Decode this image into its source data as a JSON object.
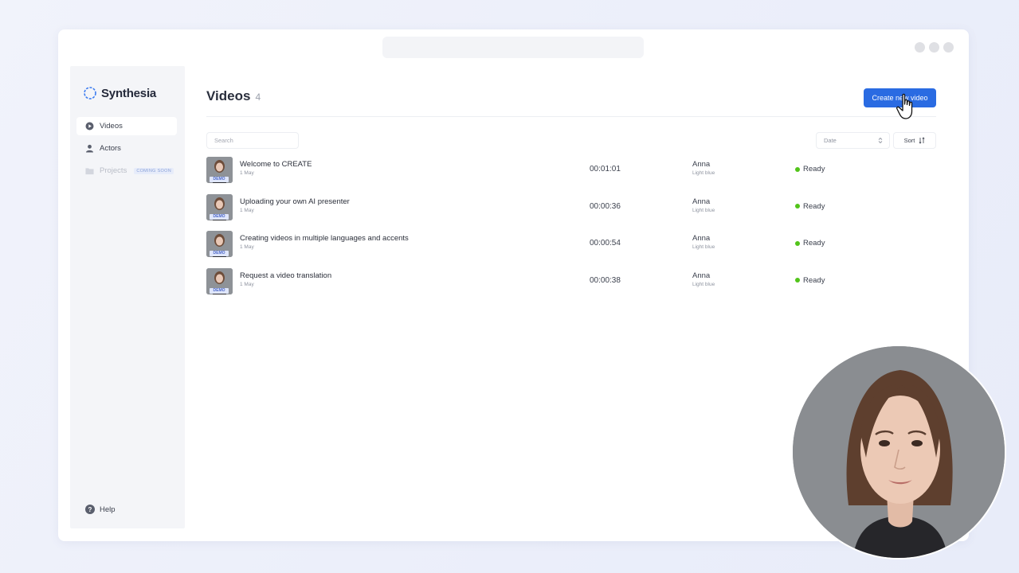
{
  "app": {
    "name": "Synthesia"
  },
  "sidebar": {
    "items": [
      {
        "label": "Videos",
        "icon": "play-circle-icon"
      },
      {
        "label": "Actors",
        "icon": "person-icon"
      },
      {
        "label": "Projects",
        "icon": "folder-icon",
        "badge": "COMING SOON"
      }
    ],
    "help_label": "Help"
  },
  "main": {
    "title": "Videos",
    "count": "4",
    "create_label": "Create new video",
    "search_placeholder": "Search",
    "date_select": "Date",
    "sort_label": "Sort"
  },
  "videos": [
    {
      "title": "Welcome to CREATE",
      "date": "1 May",
      "duration": "00:01:01",
      "actor": "Anna",
      "background": "Light blue",
      "status": "Ready",
      "tag": "DEMO"
    },
    {
      "title": "Uploading your own AI presenter",
      "date": "1 May",
      "duration": "00:00:36",
      "actor": "Anna",
      "background": "Light blue",
      "status": "Ready",
      "tag": "DEMO"
    },
    {
      "title": "Creating videos in multiple languages and accents",
      "date": "1 May",
      "duration": "00:00:54",
      "actor": "Anna",
      "background": "Light blue",
      "status": "Ready",
      "tag": "DEMO"
    },
    {
      "title": "Request a video translation",
      "date": "1 May",
      "duration": "00:00:38",
      "actor": "Anna",
      "background": "Light blue",
      "status": "Ready",
      "tag": "DEMO"
    }
  ],
  "colors": {
    "accent": "#2a6be2",
    "ready": "#52c41a",
    "sidebar_bg": "#f4f5f8"
  }
}
